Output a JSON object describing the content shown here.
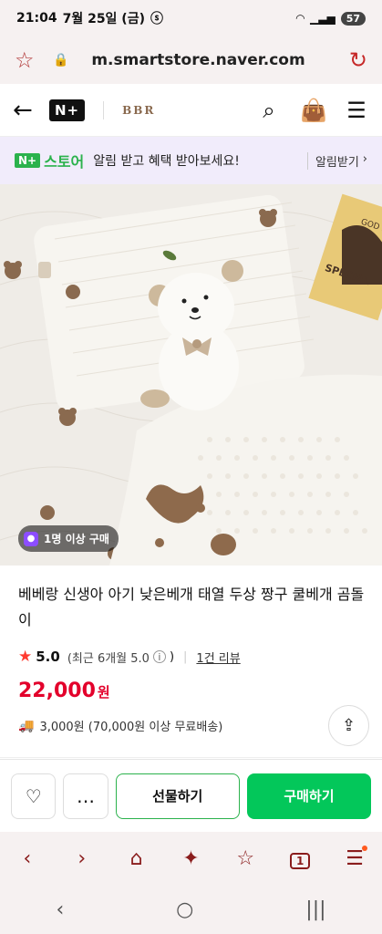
{
  "status_bar": {
    "time": "21:04",
    "date": "7월 25일 (금)",
    "battery": "57"
  },
  "url_bar": {
    "url": "m.smartstore.naver.com"
  },
  "header": {
    "logo": "N+",
    "brand": "BBR"
  },
  "promo": {
    "store_logo": "N+",
    "store_word": "스토어",
    "text": "알림 받고 혜택 받아보세요!",
    "link": "알림받기"
  },
  "product": {
    "group_badge": "1명 이상 구매",
    "title": "베베랑 신생아 아기 낮은베개 태열 두상 짱구 쿨베개 곰돌이",
    "rating": "5.0",
    "rating_recent": "(최근 6개월 5.0",
    "review_link": "1건 리뷰",
    "price": "22,000",
    "currency": "원",
    "shipping": "3,000원 (70,000원 이상 무료배송)",
    "image_sign": "GOD MA SPECIAL"
  },
  "actions": {
    "gift": "선물하기",
    "buy": "구매하기"
  },
  "toolbar": {
    "tab_count": "1"
  },
  "colors": {
    "accent_green": "#03c75a",
    "price_red": "#e3002b",
    "browser_red": "#8a1c1c"
  }
}
